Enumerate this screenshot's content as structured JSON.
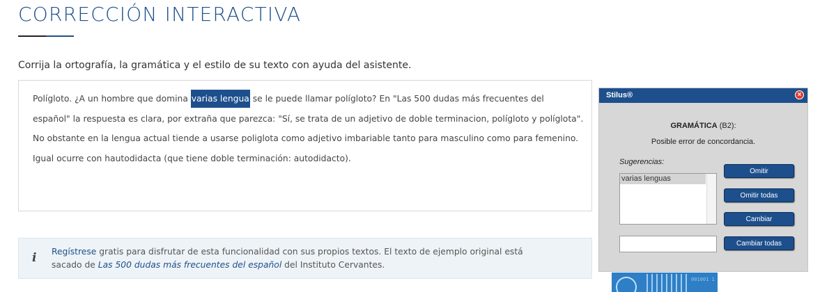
{
  "page": {
    "title": "CORRECCIÓN INTERACTIVA",
    "intro": "Corrija la ortografía, la gramática y el estilo de su texto con ayuda del asistente."
  },
  "editor": {
    "line1_pre": "Polígloto. ¿A un hombre que domina ",
    "highlight": "varias lengua",
    "line1_post": " se le puede llamar polígloto? En \"Las 500 dudas más frecuentes del",
    "line2": "español\" la respuesta es clara, por extraña que parezca: \"Sí, se trata de un adjetivo de doble terminacion, polígloto y políglota\".",
    "line3": "No obstante en la lengua actual tiende a usarse poliglota como adjetivo imbariable tanto para masculino como para femenino.",
    "line4": "Igual ocurre con hautodidacta (que tiene doble terminación: autodidacto)."
  },
  "info": {
    "icon": "i",
    "register_link": "Regístrese",
    "text1": " gratis para disfrutar de esta funcionalidad con sus propios textos. El texto de ejemplo original está",
    "text2_pre": "sacado de ",
    "book_link": "Las 500 dudas más frecuentes del español",
    "text2_post": " del Instituto Cervantes."
  },
  "dialog": {
    "title": "Stilus®",
    "close_symbol": "×",
    "category": "GRAMÁTICA",
    "level": " (B2):",
    "message": "Posible error de concordancia.",
    "suggestions_label": "Sugerencias:",
    "suggestions": [
      "varias lenguas"
    ],
    "change_value": "",
    "buttons": {
      "omit": "Omitir",
      "omit_all": "Omitir todas",
      "change": "Cambiar",
      "change_all": "Cambiar todas"
    }
  },
  "logo": {
    "text": "001001 1"
  },
  "colors": {
    "brand": "#1d4f8c",
    "dialog_bg": "#d7d7d7",
    "info_bg": "#eef3f7",
    "close": "#e03b2a"
  }
}
